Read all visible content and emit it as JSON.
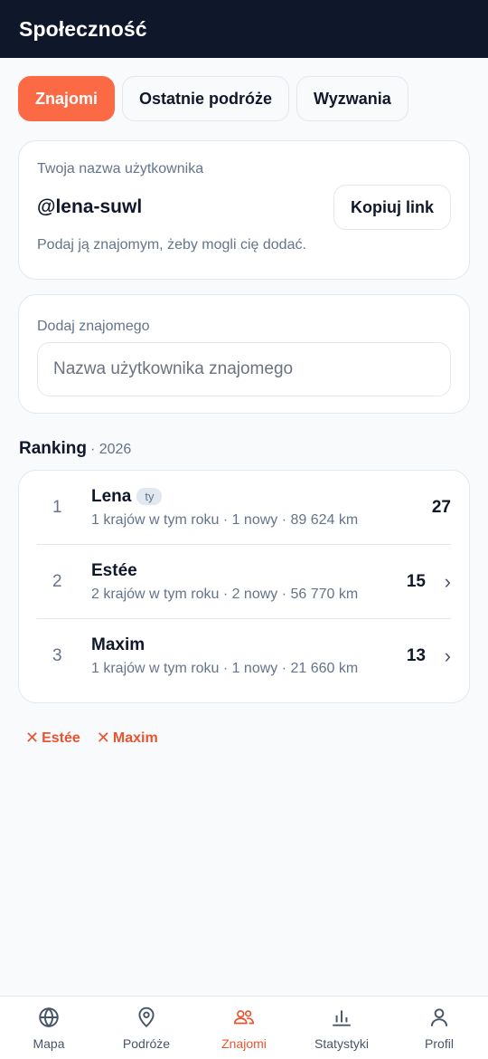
{
  "header": {
    "title": "Społeczność"
  },
  "tabs": [
    {
      "label": "Znajomi",
      "active": true
    },
    {
      "label": "Ostatnie podróże",
      "active": false
    },
    {
      "label": "Wyzwania",
      "active": false
    }
  ],
  "user_card": {
    "label": "Twoja nazwa użytkownika",
    "username": "@lena-suwl",
    "copy_label": "Kopiuj link",
    "hint": "Podaj ją znajomym, żeby mogli cię dodać."
  },
  "add_friend": {
    "label": "Dodaj znajomego",
    "placeholder": "Nazwa użytkownika znajomego",
    "value": ""
  },
  "ranking": {
    "title": "Ranking",
    "year": "· 2026",
    "rows": [
      {
        "pos": "1",
        "name": "Lena",
        "badge": "ty",
        "sub": "1 krajów w tym roku · 1 nowy · 89 624 km",
        "score": "27",
        "chevron": false
      },
      {
        "pos": "2",
        "name": "Estée",
        "badge": "",
        "sub": "2 krajów w tym roku · 2 nowy · 56 770 km",
        "score": "15",
        "chevron": true
      },
      {
        "pos": "3",
        "name": "Maxim",
        "badge": "",
        "sub": "1 krajów w tym roku · 1 nowy · 21 660 km",
        "score": "13",
        "chevron": true
      }
    ]
  },
  "removals": [
    {
      "x": "✕",
      "name": "Estée"
    },
    {
      "x": "✕",
      "name": "Maxim"
    }
  ],
  "bottom_nav": [
    {
      "label": "Mapa",
      "icon": "globe-icon",
      "active": false
    },
    {
      "label": "Podróże",
      "icon": "map-pin-icon",
      "active": false
    },
    {
      "label": "Znajomi",
      "icon": "users-icon",
      "active": true
    },
    {
      "label": "Statystyki",
      "icon": "bar-chart-icon",
      "active": false
    },
    {
      "label": "Profil",
      "icon": "user-icon",
      "active": false
    }
  ],
  "colors": {
    "accent": "#fb6a45",
    "accent_text": "#e8542f",
    "header_bg": "#0f172a",
    "muted": "#64748b"
  }
}
